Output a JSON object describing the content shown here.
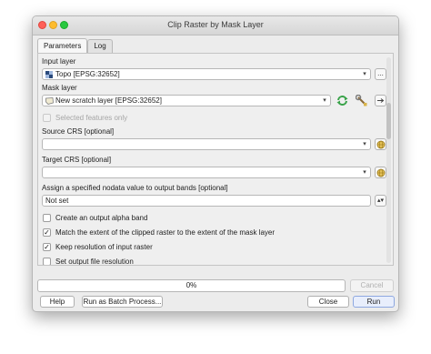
{
  "window": {
    "title": "Clip Raster by Mask Layer"
  },
  "tabs": [
    {
      "label": "Parameters",
      "active": true
    },
    {
      "label": "Log",
      "active": false
    }
  ],
  "params": {
    "input_layer": {
      "label": "Input layer",
      "value": "Topo [EPSG:32652]",
      "browse_label": "..."
    },
    "mask_layer": {
      "label": "Mask layer",
      "value": "New scratch layer [EPSG:32652]"
    },
    "selected_features_only": {
      "label": "Selected features only",
      "checked": false,
      "enabled": false
    },
    "source_crs": {
      "label": "Source CRS [optional]",
      "value": ""
    },
    "target_crs": {
      "label": "Target CRS [optional]",
      "value": ""
    },
    "nodata": {
      "label": "Assign a specified nodata value to output bands [optional]",
      "value": "Not set"
    },
    "alpha_band": {
      "label": "Create an output alpha band",
      "checked": false
    },
    "match_extent": {
      "label": "Match the extent of the clipped raster to the extent of the mask layer",
      "checked": true
    },
    "keep_resolution": {
      "label": "Keep resolution of input raster",
      "checked": true
    },
    "set_resolution": {
      "label": "Set output file resolution",
      "checked": false
    }
  },
  "progress": {
    "value": 0,
    "text": "0%"
  },
  "buttons": {
    "cancel": "Cancel",
    "help": "Help",
    "batch": "Run as Batch Process...",
    "close": "Close",
    "run": "Run"
  },
  "icons": {
    "raster_layer": "raster-layer-icon",
    "vector_layer": "polygon-layer-icon",
    "iterate": "iterate-icon",
    "settings": "wrench-icon",
    "crs": "crs-globe-icon"
  },
  "colors": {
    "iterate_green": "#3aa34a",
    "window_bg": "#ececec"
  }
}
